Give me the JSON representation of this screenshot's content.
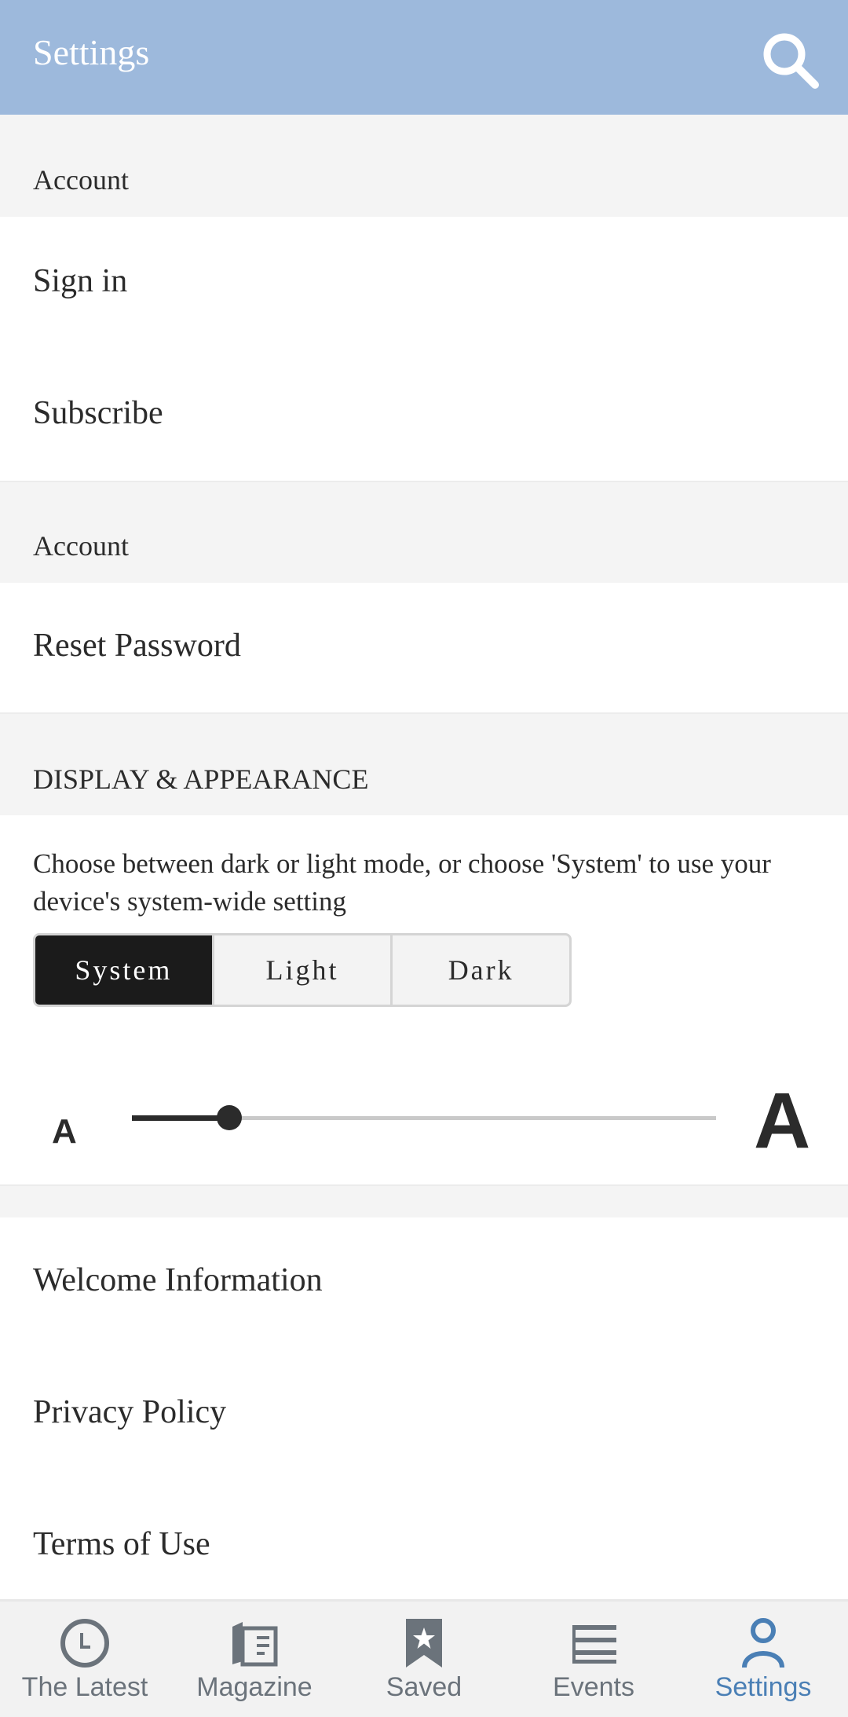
{
  "appbar": {
    "title": "Settings",
    "search_icon": "search-icon"
  },
  "sections": {
    "account1": {
      "header": "Account",
      "items": [
        "Sign in",
        "Subscribe"
      ]
    },
    "account2": {
      "header": "Account",
      "items": [
        "Reset Password"
      ]
    },
    "display": {
      "header": "DISPLAY & APPEARANCE",
      "description": "Choose between dark or light mode, or choose 'System' to use your device's system-wide setting",
      "modes": [
        "System",
        "Light",
        "Dark"
      ],
      "selected_mode": "System",
      "text_size_small_label": "A",
      "text_size_large_label": "A",
      "text_size_fraction": 0.167
    },
    "info": {
      "items": [
        "Welcome Information",
        "Privacy Policy",
        "Terms of Use"
      ]
    }
  },
  "bottom_nav": {
    "items": [
      {
        "label": "The Latest",
        "icon": "clock-icon"
      },
      {
        "label": "Magazine",
        "icon": "magazine-icon"
      },
      {
        "label": "Saved",
        "icon": "bookmark-star-icon"
      },
      {
        "label": "Events",
        "icon": "events-list-icon"
      },
      {
        "label": "Settings",
        "icon": "person-icon"
      }
    ],
    "active": "Settings"
  },
  "colors": {
    "appbar": "#9db9dc",
    "active_nav": "#4a7fb5",
    "inactive_nav": "#6b737b",
    "selected_segment": "#1b1b1b"
  }
}
